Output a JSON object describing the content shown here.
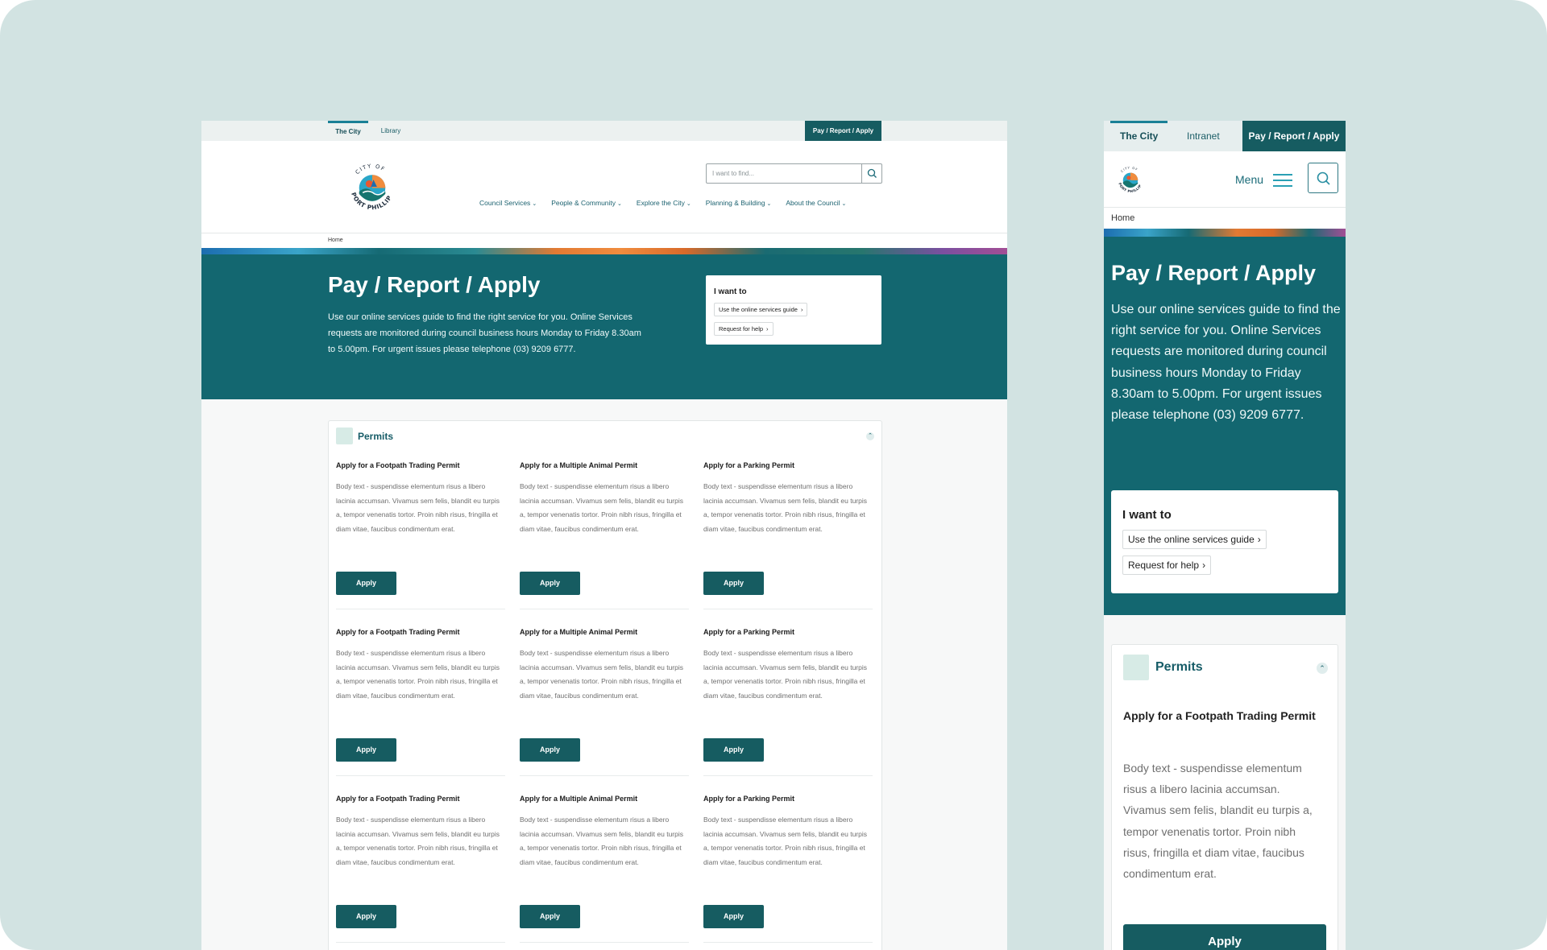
{
  "colors": {
    "canvas_bg": "#d2e3e2",
    "brand_teal": "#136770",
    "button_teal": "#165c61",
    "link_teal": "#1c6270"
  },
  "desktop": {
    "utility_tabs": [
      "The City",
      "Library"
    ],
    "pay_label": "Pay / Report / Apply",
    "search_placeholder": "I want to find...",
    "nav": [
      "Council Services",
      "People & Community",
      "Explore the City",
      "Planning & Building",
      "About the Council"
    ],
    "breadcrumb": "Home",
    "hero_title": "Pay / Report / Apply",
    "hero_text": "Use our online services guide to find the right service for you. Online Services requests are monitored during council business hours Monday to Friday 8.30am to 5.00pm. For urgent issues please telephone (03) 9209 6777.",
    "i_want_to": {
      "title": "I want to",
      "links": [
        "Use the online services guide",
        "Request for help"
      ]
    },
    "section_title": "Permits",
    "permits": [
      {
        "title": "Apply for a Footpath Trading Permit",
        "body": "Body text - suspendisse elementum risus a libero lacinia accumsan. Vivamus sem felis, blandit eu turpis a, tempor venenatis tortor. Proin nibh risus, fringilla et diam vitae, faucibus condimentum erat.",
        "button": "Apply"
      },
      {
        "title": "Apply for a Multiple Animal Permit",
        "body": "Body text - suspendisse elementum risus a libero lacinia accumsan. Vivamus sem felis, blandit eu turpis a, tempor venenatis tortor. Proin nibh risus, fringilla et diam vitae, faucibus condimentum erat.",
        "button": "Apply"
      },
      {
        "title": "Apply for a Parking Permit",
        "body": "Body text - suspendisse elementum risus a libero lacinia accumsan. Vivamus sem felis, blandit eu turpis a, tempor venenatis tortor. Proin nibh risus, fringilla et diam vitae, faucibus condimentum erat.",
        "button": "Apply"
      },
      {
        "title": "Apply for a Footpath Trading Permit",
        "body": "Body text - suspendisse elementum risus a libero lacinia accumsan. Vivamus sem felis, blandit eu turpis a, tempor venenatis tortor. Proin nibh risus, fringilla et diam vitae, faucibus condimentum erat.",
        "button": "Apply"
      },
      {
        "title": "Apply for a Multiple Animal Permit",
        "body": "Body text - suspendisse elementum risus a libero lacinia accumsan. Vivamus sem felis, blandit eu turpis a, tempor venenatis tortor. Proin nibh risus, fringilla et diam vitae, faucibus condimentum erat.",
        "button": "Apply"
      },
      {
        "title": "Apply for a Parking Permit",
        "body": "Body text - suspendisse elementum risus a libero lacinia accumsan. Vivamus sem felis, blandit eu turpis a, tempor venenatis tortor. Proin nibh risus, fringilla et diam vitae, faucibus condimentum erat.",
        "button": "Apply"
      },
      {
        "title": "Apply for a Footpath Trading Permit",
        "body": "Body text - suspendisse elementum risus a libero lacinia accumsan. Vivamus sem felis, blandit eu turpis a, tempor venenatis tortor. Proin nibh risus, fringilla et diam vitae, faucibus condimentum erat.",
        "button": "Apply"
      },
      {
        "title": "Apply for a Multiple Animal Permit",
        "body": "Body text - suspendisse elementum risus a libero lacinia accumsan. Vivamus sem felis, blandit eu turpis a, tempor venenatis tortor. Proin nibh risus, fringilla et diam vitae, faucibus condimentum erat.",
        "button": "Apply"
      },
      {
        "title": "Apply for a Parking Permit",
        "body": "Body text - suspendisse elementum risus a libero lacinia accumsan. Vivamus sem felis, blandit eu turpis a, tempor venenatis tortor. Proin nibh risus, fringilla et diam vitae, faucibus condimentum erat.",
        "button": "Apply"
      }
    ]
  },
  "mobile": {
    "utility_tabs": [
      "The City",
      "Intranet"
    ],
    "pay_label": "Pay / Report / Apply",
    "menu_label": "Menu",
    "breadcrumb": "Home",
    "hero_title": "Pay / Report / Apply",
    "hero_text": "Use our online services guide to find the right service for you. Online Services requests are monitored during council business hours Monday to Friday 8.30am to 5.00pm. For urgent issues please telephone (03) 9209 6777.",
    "i_want_to": {
      "title": "I want to",
      "links": [
        "Use the online services guide",
        "Request for help"
      ]
    },
    "section_title": "Permits",
    "permit": {
      "title": "Apply for a Footpath Trading Permit",
      "body": "Body text - suspendisse elementum risus a libero lacinia accumsan. Vivamus sem felis, blandit eu turpis a, tempor venenatis tortor. Proin nibh risus, fringilla et diam vitae, faucibus condimentum erat.",
      "button": "Apply"
    }
  },
  "logo": {
    "top_text": "CITY OF",
    "bottom_text": "PORT PHILLIP"
  }
}
